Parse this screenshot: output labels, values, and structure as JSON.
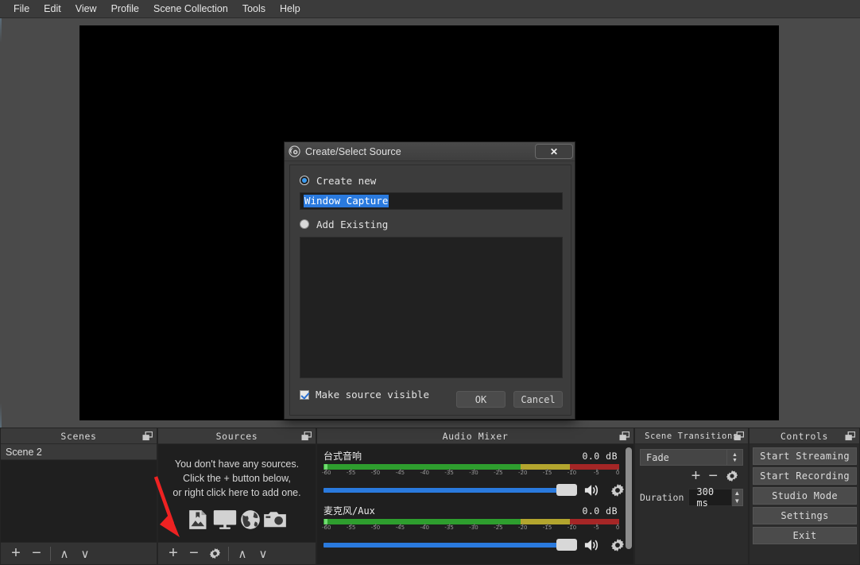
{
  "menubar": {
    "items": [
      {
        "label": "File",
        "name": "menu-file"
      },
      {
        "label": "Edit",
        "name": "menu-edit"
      },
      {
        "label": "View",
        "name": "menu-view"
      },
      {
        "label": "Profile",
        "name": "menu-profile"
      },
      {
        "label": "Scene Collection",
        "name": "menu-scene-collection"
      },
      {
        "label": "Tools",
        "name": "menu-tools"
      },
      {
        "label": "Help",
        "name": "menu-help"
      }
    ]
  },
  "dialog": {
    "title": "Create/Select Source",
    "close_label": "✕",
    "create_new_label": "Create new",
    "add_existing_label": "Add Existing",
    "source_name_value": "Window Capture",
    "make_visible_label": "Make source visible",
    "ok_label": "OK",
    "cancel_label": "Cancel",
    "existing_sources": []
  },
  "scenes": {
    "title": "Scenes",
    "items": [
      {
        "label": "Scene 2",
        "selected": true
      }
    ],
    "toolbar": {
      "add": "+",
      "remove": "−",
      "up": "∧",
      "down": "∨"
    }
  },
  "sources": {
    "title": "Sources",
    "placeholder_line1": "You don't have any sources.",
    "placeholder_line2": "Click the + button below,",
    "placeholder_line3": "or right click here to add one.",
    "toolbar": {
      "add": "+",
      "remove": "−",
      "properties": "gear",
      "up": "∧",
      "down": "∨"
    }
  },
  "mixer": {
    "title": "Audio Mixer",
    "scale_ticks": [
      "-60",
      "-55",
      "-50",
      "-45",
      "-40",
      "-35",
      "-30",
      "-25",
      "-20",
      "-15",
      "-10",
      "-5",
      "0"
    ],
    "tracks": [
      {
        "name": "台式音响",
        "db": "0.0 dB",
        "volume_percent": 100
      },
      {
        "name": "麦克风/Aux",
        "db": "0.0 dB",
        "volume_percent": 100
      }
    ]
  },
  "transitions": {
    "title": "Scene Transitions",
    "selected": "Fade",
    "duration_label": "Duration",
    "duration_value": "300 ms",
    "add": "+",
    "remove": "−"
  },
  "controls": {
    "title": "Controls",
    "buttons": [
      {
        "label": "Start Streaming",
        "name": "start-streaming-button"
      },
      {
        "label": "Start Recording",
        "name": "start-recording-button"
      },
      {
        "label": "Studio Mode",
        "name": "studio-mode-button"
      },
      {
        "label": "Settings",
        "name": "settings-button"
      },
      {
        "label": "Exit",
        "name": "exit-button"
      }
    ]
  },
  "colors": {
    "accent_blue": "#2a7ade",
    "annotation_red": "#ee2222",
    "meter_green": "#2e9e2e",
    "meter_yellow": "#b3a52e",
    "meter_red": "#a52626"
  }
}
